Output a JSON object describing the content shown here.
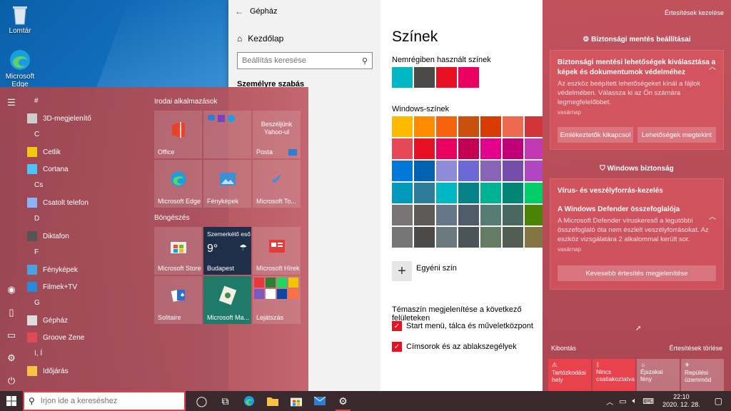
{
  "desktop": {
    "icons": [
      {
        "label": "Lomtár"
      },
      {
        "label": "Microsoft Edge"
      }
    ]
  },
  "settings": {
    "title": "Gépház",
    "home_label": "Kezdőlap",
    "search_placeholder": "Beállítás keresése",
    "section_label": "Személyre szabás",
    "page_title": "Színek",
    "recent_label": "Nemrégiben használt színek",
    "recent_colors": [
      "#00b7c3",
      "#4c4a48",
      "#e81123",
      "#ea005e"
    ],
    "windows_colors_label": "Windows-színek",
    "windows_colors": [
      "#ffb900",
      "#ff8c00",
      "#f7630c",
      "#ca5010",
      "#da3b01",
      "#ef6950",
      "#d13438",
      "#e74856",
      "#e81123",
      "#ea005e",
      "#c30052",
      "#e3008c",
      "#bf0077",
      "#c239b3",
      "#0078d7",
      "#0063b1",
      "#8e8cd8",
      "#6b69d6",
      "#8764b8",
      "#744da9",
      "#b146c2",
      "#0099bc",
      "#2d7d9a",
      "#00b7c3",
      "#038387",
      "#00b294",
      "#018574",
      "#00cc6a",
      "#7a7574",
      "#5d5a58",
      "#68768a",
      "#515c6b",
      "#567c73",
      "#486860",
      "#498205",
      "#767676",
      "#4c4a48",
      "#69797e",
      "#4a5459",
      "#647c64",
      "#525e54",
      "#847545"
    ],
    "custom_color_label": "Egyéni szín",
    "show_accent_label": "Témaszín megjelenítése a következő felületeken",
    "check1_label": "Start menü, tálca és műveletközpont",
    "check2_label": "Címsorok és az ablakszegélyek"
  },
  "start": {
    "apps": [
      {
        "type": "letter",
        "text": "#"
      },
      {
        "type": "app",
        "text": "3D-megjelenítő",
        "color": "#cccccc"
      },
      {
        "type": "letter",
        "text": "C"
      },
      {
        "type": "app",
        "text": "Cetlik",
        "color": "#f2c811"
      },
      {
        "type": "app",
        "text": "Cortana",
        "color": "#4fc3f7"
      },
      {
        "type": "letter",
        "text": "Cs"
      },
      {
        "type": "app",
        "text": "Csatolt telefon",
        "color": "#8ab4f8"
      },
      {
        "type": "letter",
        "text": "D"
      },
      {
        "type": "app",
        "text": "Diktafon",
        "color": "#555555"
      },
      {
        "type": "letter",
        "text": "F"
      },
      {
        "type": "app",
        "text": "Fényképek",
        "color": "#4aa3df"
      },
      {
        "type": "app",
        "text": "Filmek+TV",
        "color": "#2b88d8"
      },
      {
        "type": "letter",
        "text": "G"
      },
      {
        "type": "app",
        "text": "Gépház",
        "color": "#dddddd"
      },
      {
        "type": "app",
        "text": "Groove Zene",
        "color": "#e04a52"
      },
      {
        "type": "letter",
        "text": "I, Í"
      },
      {
        "type": "app",
        "text": "Időjárás",
        "color": "#f6c342"
      }
    ],
    "group1": "Irodai alkalmazások",
    "group2": "Böngészés",
    "tiles": {
      "office": "Office",
      "posta_top": "Beszéljünk Yahoo-ul",
      "posta": "Posta",
      "edge": "Microsoft Edge",
      "photos": "Fényképek",
      "todo": "Microsoft To...",
      "store": "Microsoft Store",
      "weather_title": "Szemerkélő eső",
      "weather_temp": "9°",
      "weather_city": "Budapest",
      "news": "Microsoft Hírek",
      "solitaire": "Solitaire",
      "mahjong": "Microsoft Ma...",
      "play": "Lejátszás"
    }
  },
  "action_center": {
    "manage": "Értesítések kezelése",
    "group1": "Biztonsági mentés beállításai",
    "n1_title": "Biztonsági mentési lehetőségek kiválasztása a képek és dokumentumok védelméhez",
    "n1_body": "Az eszköz beépített lehetőségeket kínál a fájlok védelmében. Válassza ki az Ön számára legmegfelelőbbet.",
    "n1_date": "vasárnap",
    "n1_btn1": "Emlékeztetők kikapcsol",
    "n1_btn2": "Lehetőségek megtekint",
    "group2": "Windows biztonság",
    "n2_head": "Vírus- és veszélyforrás-kezelés",
    "n2_title": "A Windows Defender összefoglalója",
    "n2_body": "A Microsoft Defender víruskereső a legutóbbi összefoglaló óta nem észlelt veszélyforrásokat. Az eszköz vizsgálatára 2 alkalommal került sor.",
    "n2_date": "vasárnap",
    "less_btn": "Kevesebb értesítés megjelenítése",
    "expand": "Kibontás",
    "clear": "Értesítések törlése",
    "quick": [
      {
        "label": "Tartózkodási hely",
        "on": true
      },
      {
        "label": "Nincs csatlakoztatva",
        "on": true
      },
      {
        "label": "Éjszakai fény",
        "on": false
      },
      {
        "label": "Repülési üzemmód",
        "on": false
      }
    ]
  },
  "taskbar": {
    "search_placeholder": "Írjon ide a kereséshez",
    "time": "22:10",
    "date": "2020. 12. 28."
  }
}
